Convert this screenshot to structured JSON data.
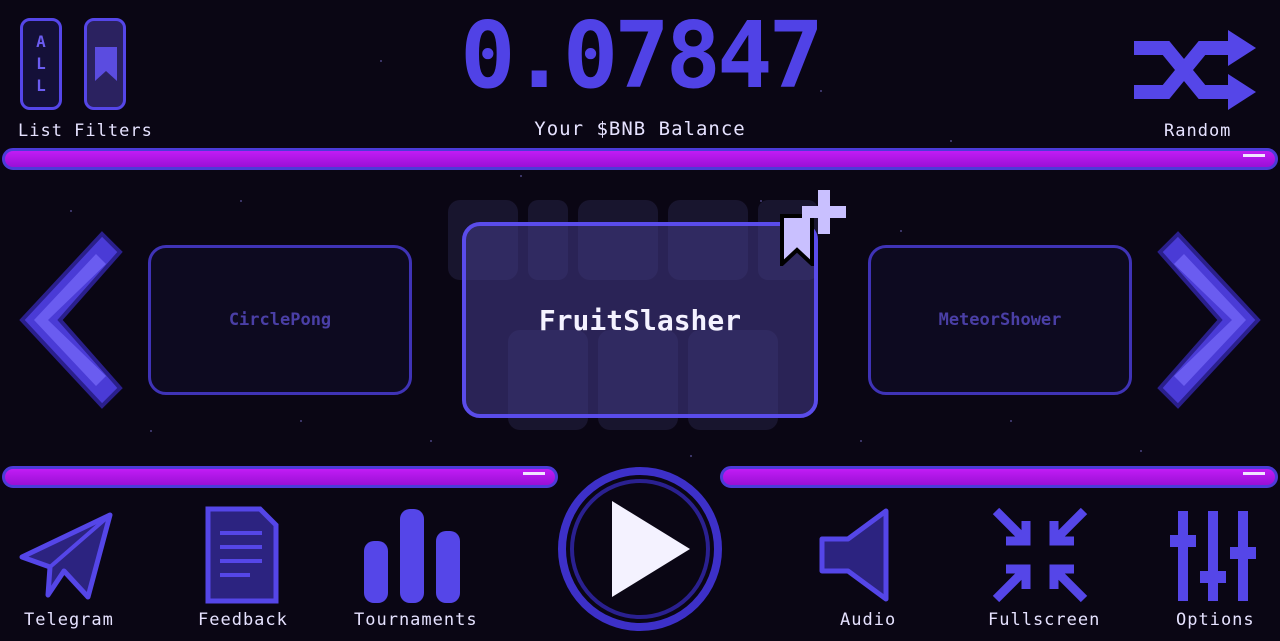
{
  "filters": {
    "all_letters": [
      "A",
      "L",
      "L"
    ],
    "caption": "List Filters"
  },
  "balance": {
    "value": "0.07847",
    "label": "Your $BNB Balance"
  },
  "random": {
    "caption": "Random"
  },
  "carousel": {
    "prev_game": "CirclePong",
    "current_game": "FruitSlasher",
    "next_game": "MeteorShower"
  },
  "bottom_nav": {
    "telegram": "Telegram",
    "feedback": "Feedback",
    "tournaments": "Tournaments",
    "audio": "Audio",
    "fullscreen": "Fullscreen",
    "options": "Options"
  },
  "colors": {
    "accent": "#5546e8",
    "bar": "#c11cf5",
    "background": "#0a0614"
  }
}
